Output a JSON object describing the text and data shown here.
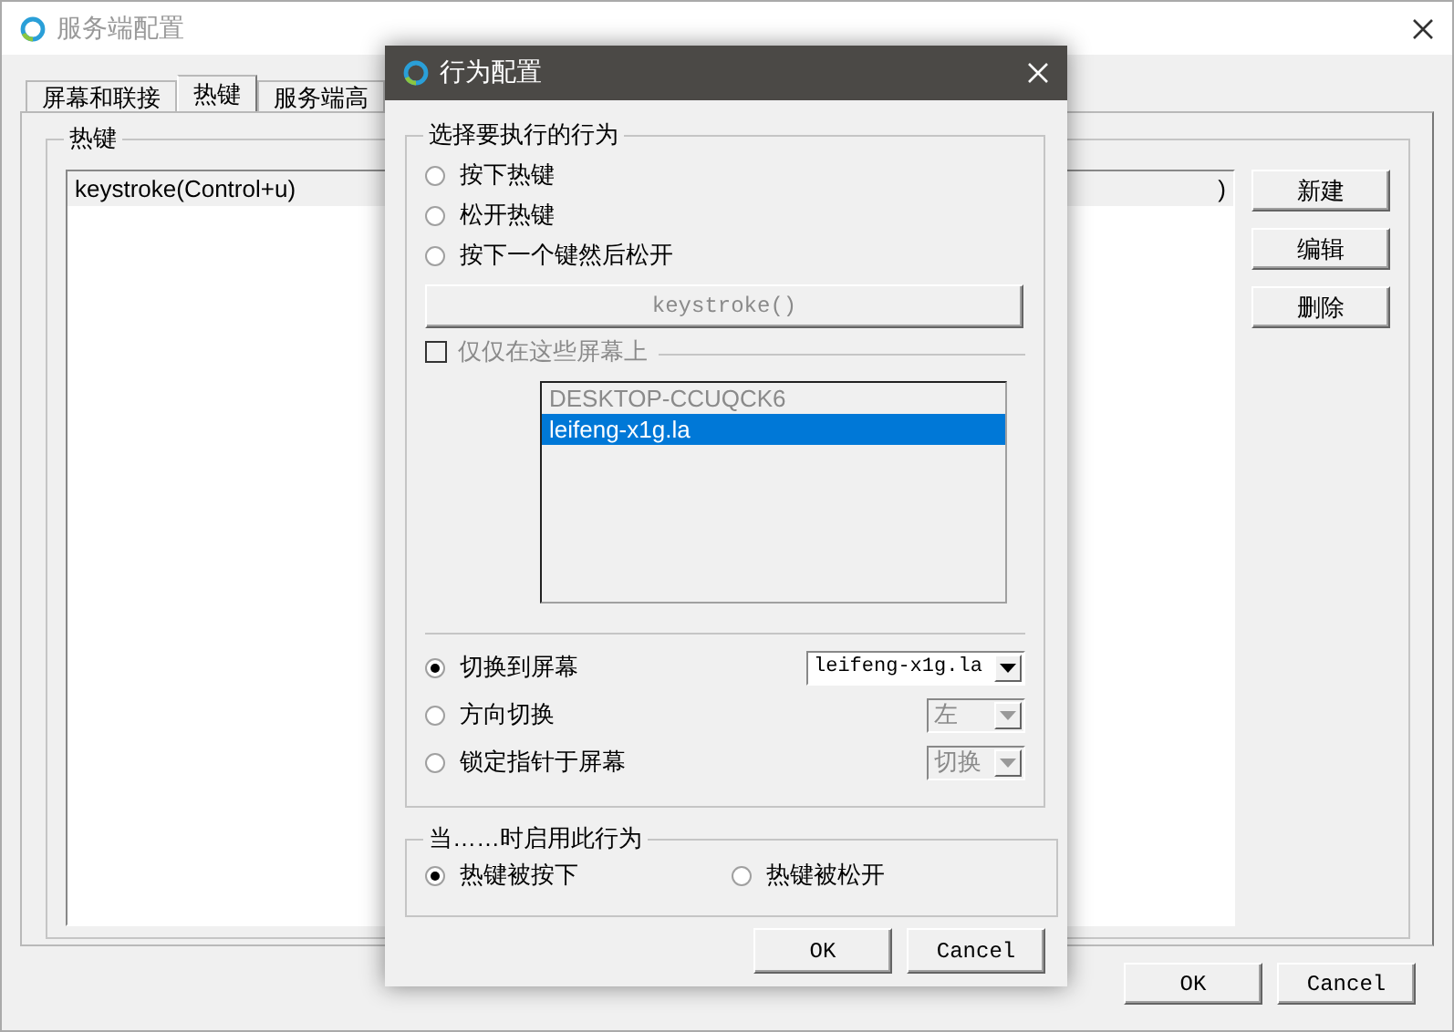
{
  "window": {
    "title": "服务端配置"
  },
  "tabs": [
    {
      "label": "屏幕和联接",
      "selected": false
    },
    {
      "label": "热键",
      "selected": true
    },
    {
      "label": "服务端高",
      "selected": false
    }
  ],
  "hotkeys": {
    "title": "热键",
    "rows": [
      {
        "column_1": "keystroke(Control+u)",
        "column_2": ")",
        "selected": true
      }
    ],
    "buttons": [
      "新建",
      "编辑",
      "删除"
    ]
  },
  "buttons": [
    "OK",
    "Cancel"
  ],
  "dialog": {
    "title": "行为配置",
    "action_group": {
      "title": "选择要执行的行为",
      "options": [
        {
          "label": "按下热键",
          "selected": false
        },
        {
          "label": "松开热键",
          "selected": false
        },
        {
          "label": "按下一个键然后松开",
          "selected": false
        }
      ],
      "keystroke_button": {
        "label": "keystroke()",
        "disabled": true
      },
      "screens_only": {
        "label": "仅仅在这些屏幕上",
        "checked": false,
        "disabled": true
      },
      "screens": [
        {
          "label": "DESKTOP-CCUQCK6",
          "selected": false
        },
        {
          "label": "leifeng-x1g.la",
          "selected": true
        }
      ],
      "switch_options": [
        {
          "label": "切换到屏幕",
          "selected": true,
          "value": "leifeng-x1g.la",
          "disabled": false
        },
        {
          "label": "方向切换",
          "selected": false,
          "value": "左",
          "disabled": true
        },
        {
          "label": "锁定指针于屏幕",
          "selected": false,
          "value": "切换",
          "disabled": true
        }
      ]
    },
    "trigger_group": {
      "title": "当……时启用此行为",
      "options": [
        {
          "label": "热键被按下",
          "selected": true
        },
        {
          "label": "热键被松开",
          "selected": false
        }
      ]
    },
    "buttons": [
      "OK",
      "Cancel"
    ]
  }
}
